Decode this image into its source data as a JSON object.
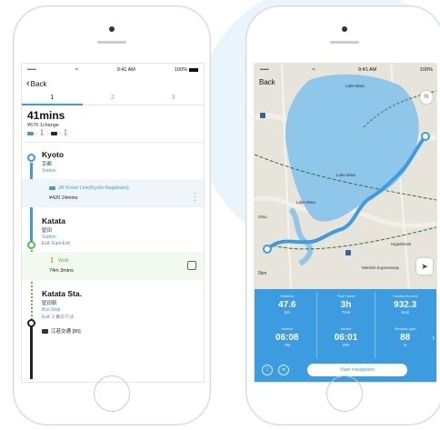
{
  "left": {
    "status": {
      "signal": "•••••",
      "wifi": "≈",
      "time": "9:41 AM",
      "battery": "100%"
    },
    "back_label": "Back",
    "tabs": [
      "1",
      "2",
      "3"
    ],
    "summary": {
      "duration": "41mins",
      "fare_change": "¥670  1change"
    },
    "stations": [
      {
        "name": "Kyoto",
        "jp": "京都",
        "sub": "Station"
      },
      {
        "name": "Katata",
        "jp": "堅田",
        "sub": "Station",
        "exit": "Exit: East Exit"
      },
      {
        "name": "Katata Sta.",
        "jp": "堅田駅",
        "sub": "Bus Stop",
        "exit": "Exit: 2 番のりば"
      }
    ],
    "train_segment": {
      "line": "JR Kosei Line(Kyoto-Nagahara)",
      "detail": "¥420  24mins"
    },
    "walk_segment": {
      "label": "Walk",
      "detail": "74m  3mins"
    },
    "bus_segment": {
      "line": "江若交通 [80]"
    }
  },
  "right": {
    "status": {
      "signal": "•••••",
      "wifi": "≈",
      "time": "9:41 AM",
      "battery": "100%"
    },
    "back_label": "Back",
    "compass_label": "N",
    "scale_label": "5km",
    "map_labels": {
      "lake1": "Lake Biwa",
      "lake2": "Lake Biwa",
      "lake3": "Lake Biwa",
      "city": "Otsu",
      "hwy": "Meishin Expressway",
      "h2": "Higashiomi"
    },
    "stats": [
      {
        "header": "Distance",
        "value": "47.6",
        "unit": "km"
      },
      {
        "header": "Time Spent",
        "value": "3h",
        "unit": "7min"
      },
      {
        "header": "Calories Burned",
        "value": "932.3",
        "unit": "kcal"
      },
      {
        "header": "Sunrise",
        "value": "06:08",
        "unit": "AM"
      },
      {
        "header": "Sunset",
        "value": "06:01",
        "unit": "PM"
      },
      {
        "header": "Elevation gain",
        "value": "88",
        "unit": "m"
      }
    ],
    "start_button": "Start navigation"
  }
}
